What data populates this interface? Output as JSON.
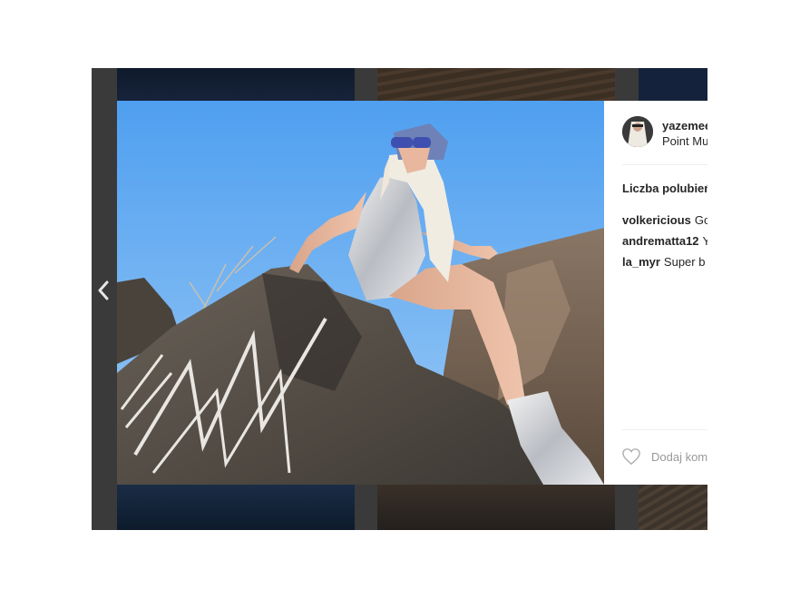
{
  "post": {
    "username": "yazemee",
    "location": "Point Mu",
    "likes_label": "Liczba polubień",
    "comments": [
      {
        "user": "volkericious",
        "text": "Go"
      },
      {
        "user": "andrematta12",
        "text": "Y"
      },
      {
        "user": "la_myr",
        "text": "Super b"
      }
    ],
    "add_comment_placeholder": "Dodaj kom"
  },
  "icons": {
    "prev": "chevron-left-icon",
    "like": "heart-icon"
  },
  "colors": {
    "sky": "#5aa6ee",
    "panel_text": "#262626",
    "muted_text": "#999999",
    "backdrop": "#3a3a3a"
  }
}
